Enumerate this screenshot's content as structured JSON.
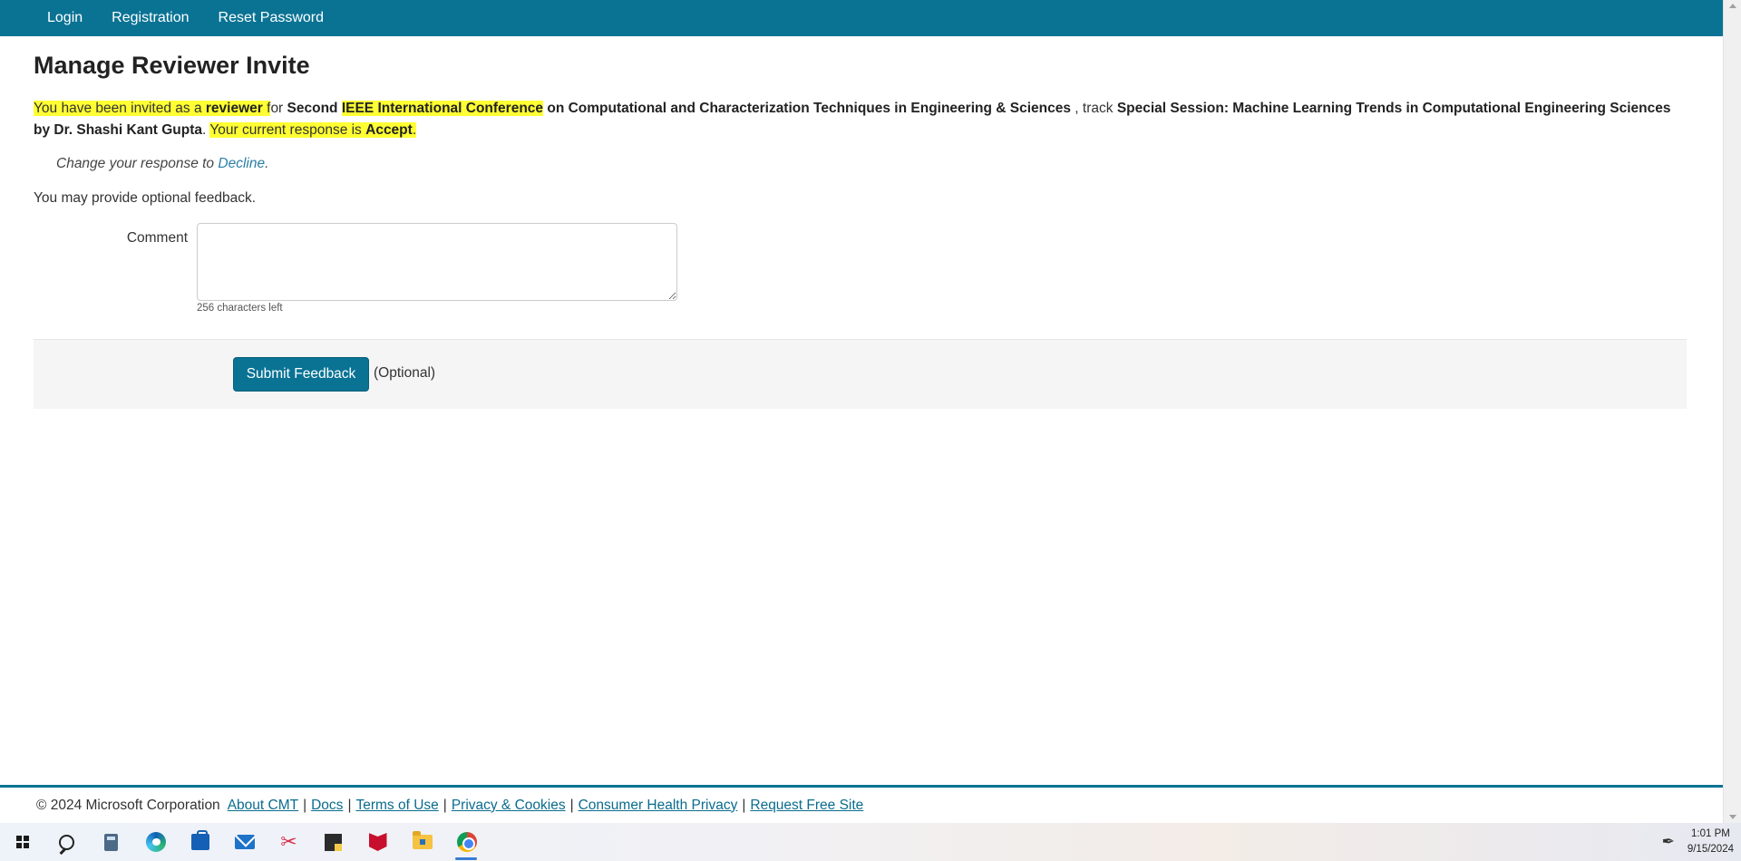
{
  "nav": {
    "items": [
      "Login",
      "Registration",
      "Reset Password"
    ]
  },
  "page": {
    "title": "Manage Reviewer Invite"
  },
  "invite": {
    "seg1": "You have been invited as a ",
    "role": "reviewer",
    "seg2": " f",
    "seg3": "or ",
    "conf_prefix": "Second",
    "conf_highlight": "IEEE International Conference",
    "conf_suffix": "on Computational and Characterization Techniques in Engineering & Sciences",
    "track_word": " , track ",
    "track_name": "Special Session: Machine Learning Trends in Computational Engineering Sciences by Dr. Shashi Kant Gupta",
    "seg4": ". ",
    "response_text": "Your current response is ",
    "response_value": "Accept",
    "seg5": "."
  },
  "change": {
    "text": "Change your response to ",
    "link": "Decline",
    "end": "."
  },
  "feedback": {
    "hint": "You may provide optional feedback.",
    "comment_label": "Comment",
    "comment_value": "",
    "chars_left": "256 characters left",
    "submit_label": "Submit Feedback",
    "optional_label": "(Optional)"
  },
  "footer": {
    "copyright": "© 2024 Microsoft Corporation",
    "links": [
      "About CMT",
      "Docs",
      "Terms of Use",
      "Privacy & Cookies",
      "Consumer Health Privacy",
      "Request Free Site"
    ],
    "separator": "|"
  },
  "taskbar": {
    "icons": [
      "windows-start-icon",
      "search-icon",
      "calculator-icon",
      "edge-icon",
      "store-icon",
      "mail-icon",
      "snipping-tool-icon",
      "sticky-notes-icon",
      "mcafee-icon",
      "file-explorer-icon",
      "chrome-icon"
    ],
    "time": "1:01 PM",
    "date": "9/15/2024"
  },
  "colors": {
    "brand": "#0a7394",
    "highlight": "#ffff33",
    "link": "#2a7fa6"
  }
}
